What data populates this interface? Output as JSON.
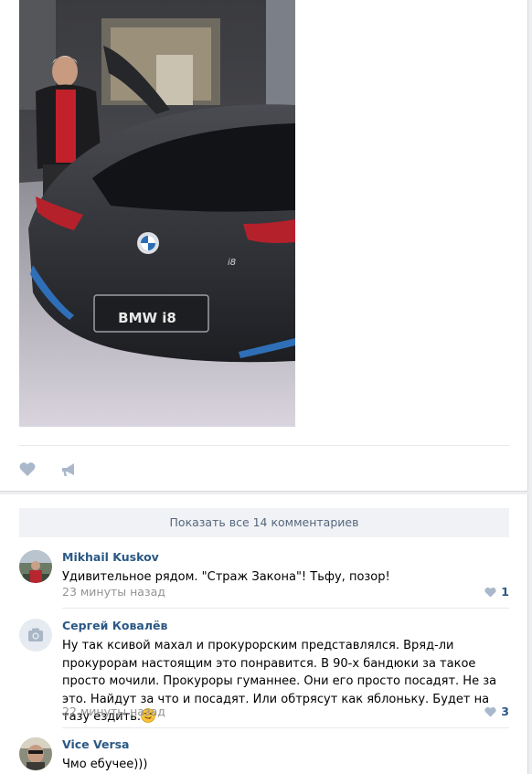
{
  "post": {
    "photo_alt": "",
    "actions": {
      "like_icon": "heart-icon",
      "share_icon": "megaphone-icon"
    }
  },
  "comments_section": {
    "show_all_label": "Показать все 14 комментариев",
    "comments": [
      {
        "author": "Mikhail Kuskov",
        "text": "Удивительное рядом. \"Страж Закона\"! Тьфу, позор!",
        "time": "23 минуты назад",
        "likes": "1"
      },
      {
        "author": "Сергей Ковалёв",
        "text": "Ну так ксивой махал и прокурорским представлялся. Вряд-ли прокурорам настоящим это понравится. В 90-х бандюки за такое просто мочили. Прокуроры гуманнее. Они его просто посадят. Не за это. Найдут за что и посадят. Или обтрясут как яблоньку. Будет на тазу ездить.",
        "time": "22 минуты назад",
        "likes": "3",
        "emoji": "wink-tongue-emoji"
      },
      {
        "author": "Vice Versa",
        "text": "Чмо ебучее)))"
      }
    ]
  },
  "colors": {
    "link": "#2a5885",
    "muted": "#939393",
    "icon": "#a9b8ca",
    "show_all_bg": "#f0f2f5"
  }
}
